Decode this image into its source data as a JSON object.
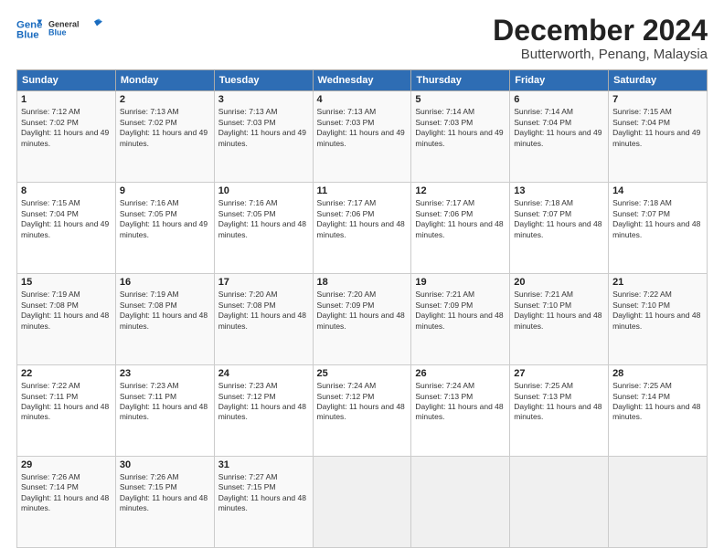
{
  "logo": {
    "line1": "General",
    "line2": "Blue"
  },
  "title": "December 2024",
  "subtitle": "Butterworth, Penang, Malaysia",
  "weekdays": [
    "Sunday",
    "Monday",
    "Tuesday",
    "Wednesday",
    "Thursday",
    "Friday",
    "Saturday"
  ],
  "weeks": [
    [
      {
        "day": "1",
        "sunrise": "7:12 AM",
        "sunset": "7:02 PM",
        "dh": "11 hours and 49 minutes."
      },
      {
        "day": "2",
        "sunrise": "7:13 AM",
        "sunset": "7:02 PM",
        "dh": "11 hours and 49 minutes."
      },
      {
        "day": "3",
        "sunrise": "7:13 AM",
        "sunset": "7:03 PM",
        "dh": "11 hours and 49 minutes."
      },
      {
        "day": "4",
        "sunrise": "7:13 AM",
        "sunset": "7:03 PM",
        "dh": "11 hours and 49 minutes."
      },
      {
        "day": "5",
        "sunrise": "7:14 AM",
        "sunset": "7:03 PM",
        "dh": "11 hours and 49 minutes."
      },
      {
        "day": "6",
        "sunrise": "7:14 AM",
        "sunset": "7:04 PM",
        "dh": "11 hours and 49 minutes."
      },
      {
        "day": "7",
        "sunrise": "7:15 AM",
        "sunset": "7:04 PM",
        "dh": "11 hours and 49 minutes."
      }
    ],
    [
      {
        "day": "8",
        "sunrise": "7:15 AM",
        "sunset": "7:04 PM",
        "dh": "11 hours and 49 minutes."
      },
      {
        "day": "9",
        "sunrise": "7:16 AM",
        "sunset": "7:05 PM",
        "dh": "11 hours and 49 minutes."
      },
      {
        "day": "10",
        "sunrise": "7:16 AM",
        "sunset": "7:05 PM",
        "dh": "11 hours and 48 minutes."
      },
      {
        "day": "11",
        "sunrise": "7:17 AM",
        "sunset": "7:06 PM",
        "dh": "11 hours and 48 minutes."
      },
      {
        "day": "12",
        "sunrise": "7:17 AM",
        "sunset": "7:06 PM",
        "dh": "11 hours and 48 minutes."
      },
      {
        "day": "13",
        "sunrise": "7:18 AM",
        "sunset": "7:07 PM",
        "dh": "11 hours and 48 minutes."
      },
      {
        "day": "14",
        "sunrise": "7:18 AM",
        "sunset": "7:07 PM",
        "dh": "11 hours and 48 minutes."
      }
    ],
    [
      {
        "day": "15",
        "sunrise": "7:19 AM",
        "sunset": "7:08 PM",
        "dh": "11 hours and 48 minutes."
      },
      {
        "day": "16",
        "sunrise": "7:19 AM",
        "sunset": "7:08 PM",
        "dh": "11 hours and 48 minutes."
      },
      {
        "day": "17",
        "sunrise": "7:20 AM",
        "sunset": "7:08 PM",
        "dh": "11 hours and 48 minutes."
      },
      {
        "day": "18",
        "sunrise": "7:20 AM",
        "sunset": "7:09 PM",
        "dh": "11 hours and 48 minutes."
      },
      {
        "day": "19",
        "sunrise": "7:21 AM",
        "sunset": "7:09 PM",
        "dh": "11 hours and 48 minutes."
      },
      {
        "day": "20",
        "sunrise": "7:21 AM",
        "sunset": "7:10 PM",
        "dh": "11 hours and 48 minutes."
      },
      {
        "day": "21",
        "sunrise": "7:22 AM",
        "sunset": "7:10 PM",
        "dh": "11 hours and 48 minutes."
      }
    ],
    [
      {
        "day": "22",
        "sunrise": "7:22 AM",
        "sunset": "7:11 PM",
        "dh": "11 hours and 48 minutes."
      },
      {
        "day": "23",
        "sunrise": "7:23 AM",
        "sunset": "7:11 PM",
        "dh": "11 hours and 48 minutes."
      },
      {
        "day": "24",
        "sunrise": "7:23 AM",
        "sunset": "7:12 PM",
        "dh": "11 hours and 48 minutes."
      },
      {
        "day": "25",
        "sunrise": "7:24 AM",
        "sunset": "7:12 PM",
        "dh": "11 hours and 48 minutes."
      },
      {
        "day": "26",
        "sunrise": "7:24 AM",
        "sunset": "7:13 PM",
        "dh": "11 hours and 48 minutes."
      },
      {
        "day": "27",
        "sunrise": "7:25 AM",
        "sunset": "7:13 PM",
        "dh": "11 hours and 48 minutes."
      },
      {
        "day": "28",
        "sunrise": "7:25 AM",
        "sunset": "7:14 PM",
        "dh": "11 hours and 48 minutes."
      }
    ],
    [
      {
        "day": "29",
        "sunrise": "7:26 AM",
        "sunset": "7:14 PM",
        "dh": "11 hours and 48 minutes."
      },
      {
        "day": "30",
        "sunrise": "7:26 AM",
        "sunset": "7:15 PM",
        "dh": "11 hours and 48 minutes."
      },
      {
        "day": "31",
        "sunrise": "7:27 AM",
        "sunset": "7:15 PM",
        "dh": "11 hours and 48 minutes."
      },
      null,
      null,
      null,
      null
    ]
  ],
  "labels": {
    "sunrise": "Sunrise:",
    "sunset": "Sunset:",
    "daylight": "Daylight:"
  }
}
